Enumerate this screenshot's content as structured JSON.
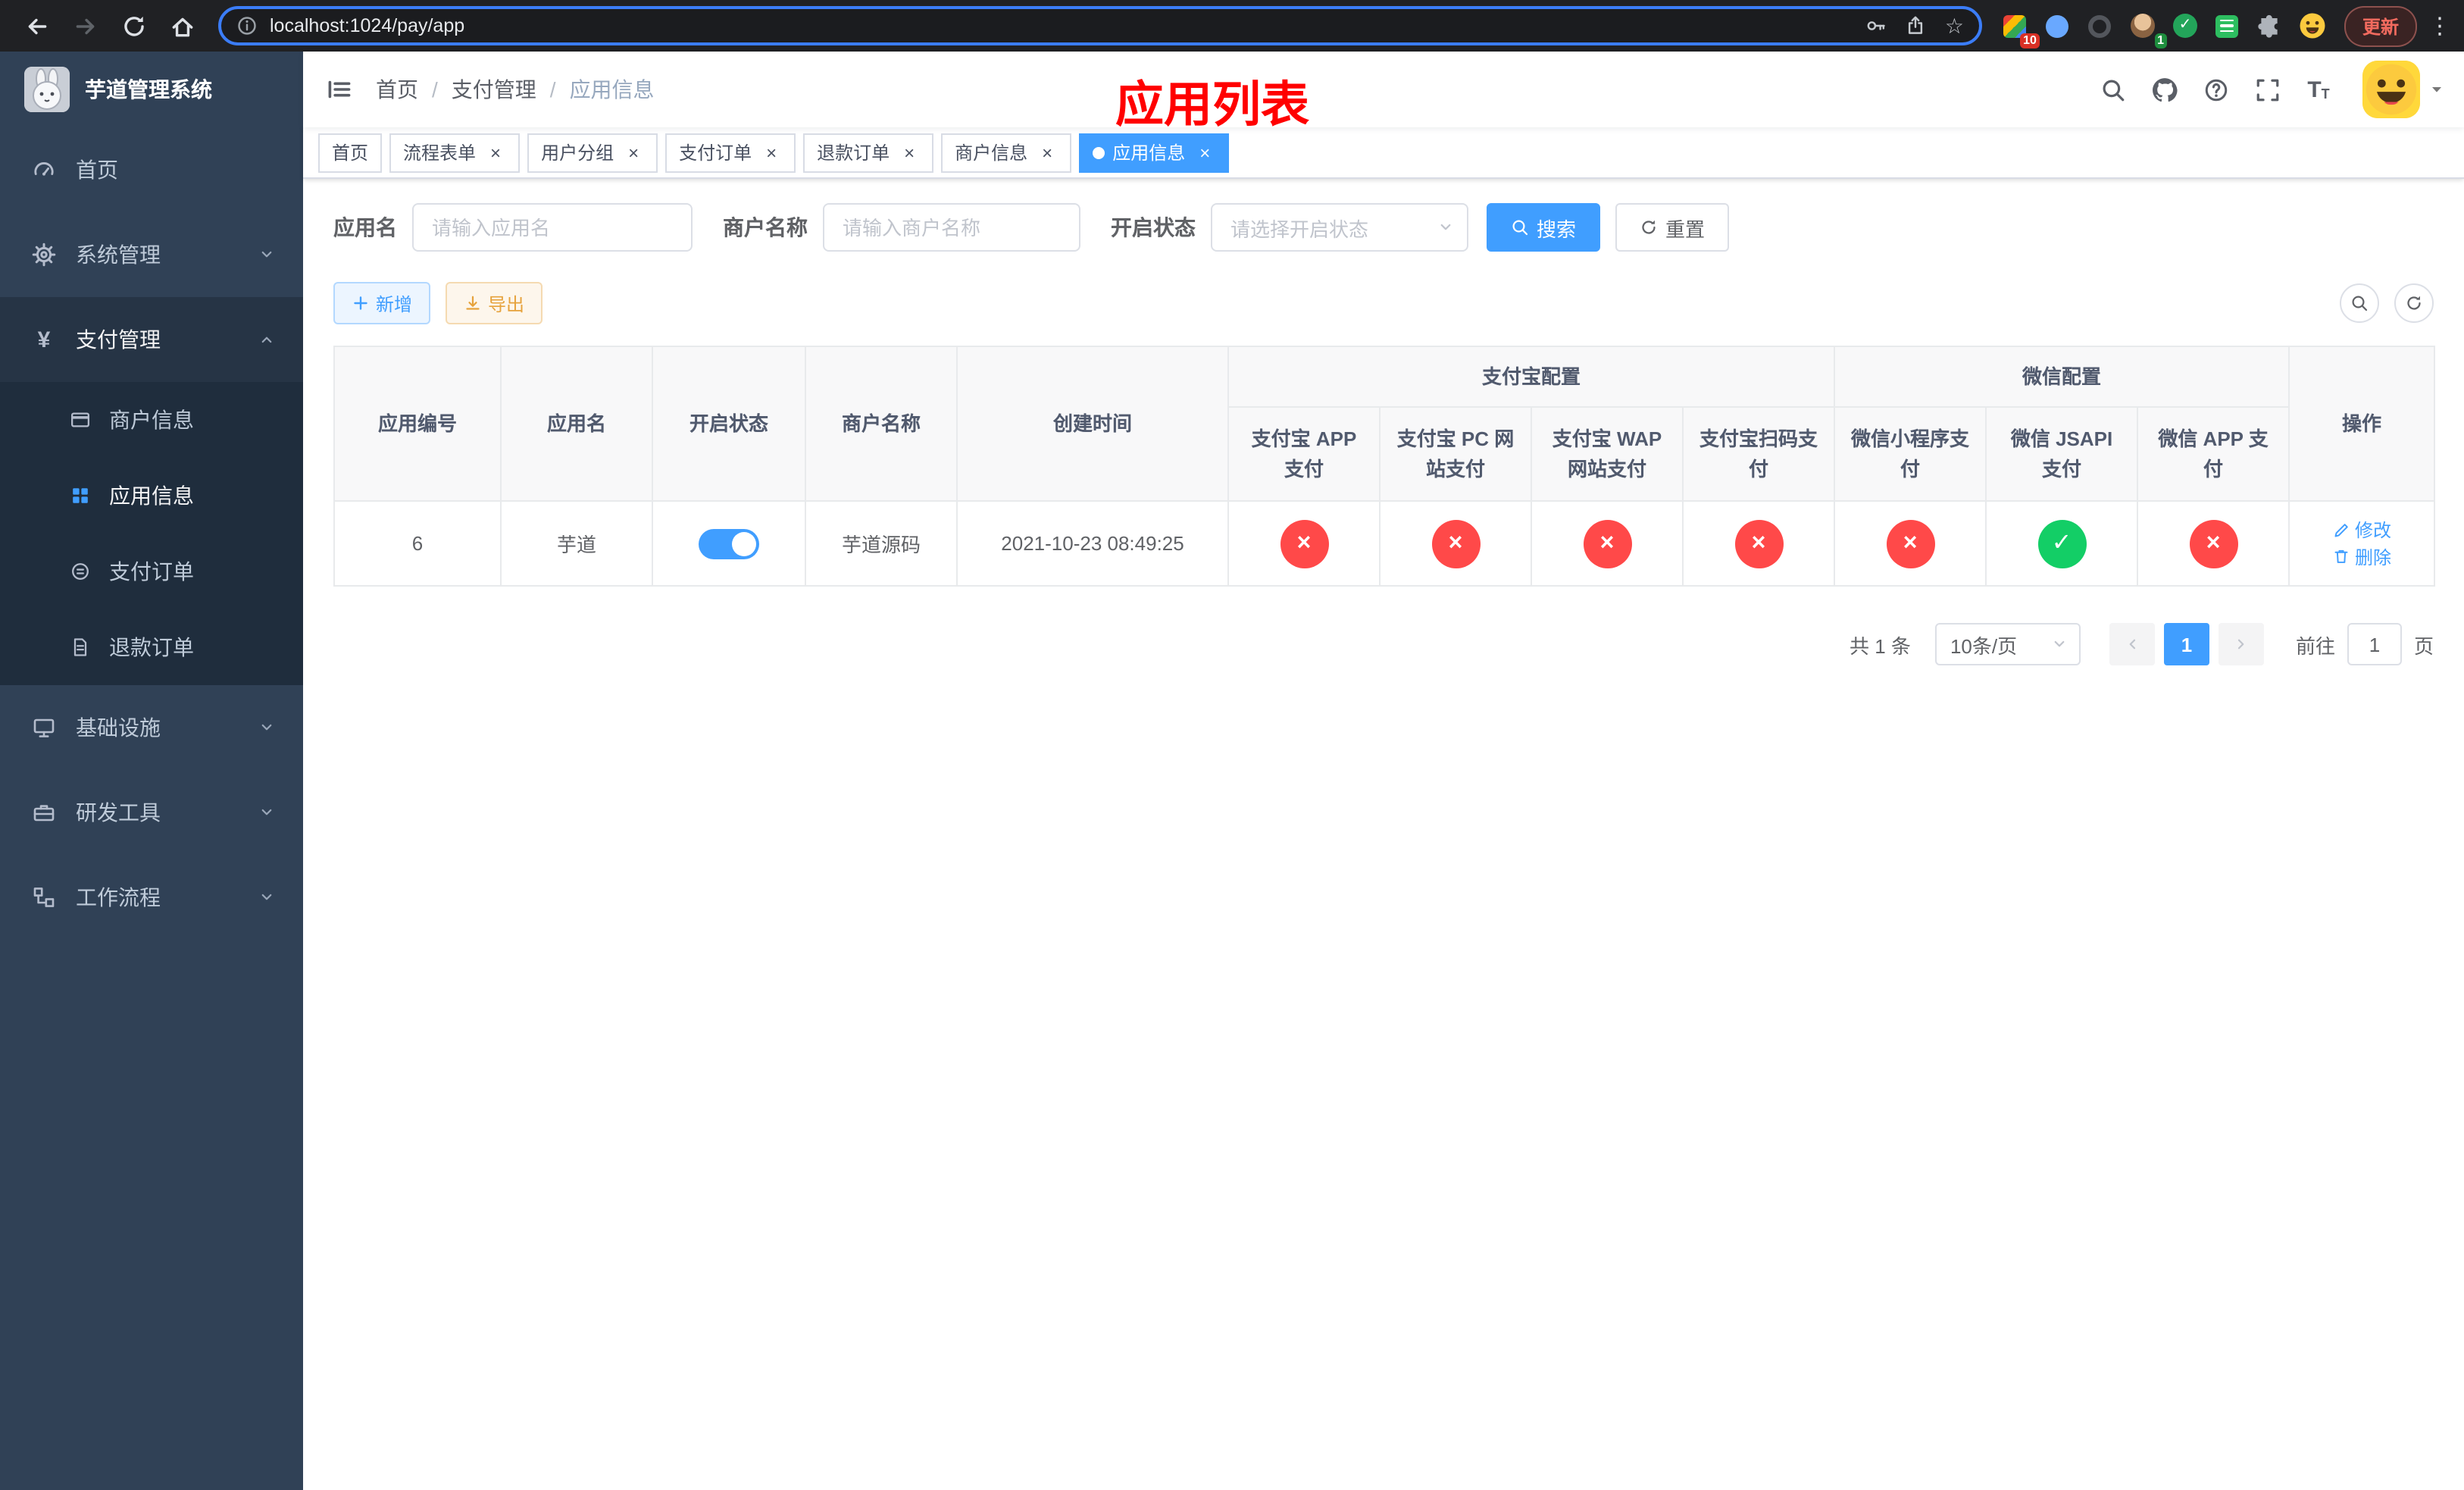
{
  "colors": {
    "accent": "#409eff",
    "success": "#13ce66",
    "danger": "#ff4949",
    "sidebar_bg": "#304156",
    "annotation": "#ff0000"
  },
  "browser": {
    "url": "localhost:1024/pay/app",
    "update_label": "更新",
    "extension_badge": "10",
    "avatar_badge": "1"
  },
  "sidebar": {
    "logo_title": "芋道管理系统",
    "items": [
      {
        "label": "首页"
      },
      {
        "label": "系统管理"
      },
      {
        "label": "支付管理",
        "children": [
          {
            "label": "商户信息"
          },
          {
            "label": "应用信息"
          },
          {
            "label": "支付订单"
          },
          {
            "label": "退款订单"
          }
        ]
      },
      {
        "label": "基础设施"
      },
      {
        "label": "研发工具"
      },
      {
        "label": "工作流程"
      }
    ]
  },
  "header": {
    "breadcrumb": [
      "首页",
      "支付管理",
      "应用信息"
    ],
    "separator": "/",
    "annotation": "应用列表"
  },
  "tabs": [
    {
      "label": "首页"
    },
    {
      "label": "流程表单"
    },
    {
      "label": "用户分组"
    },
    {
      "label": "支付订单"
    },
    {
      "label": "退款订单"
    },
    {
      "label": "商户信息"
    },
    {
      "label": "应用信息"
    }
  ],
  "filter": {
    "app_name_label": "应用名",
    "app_name_placeholder": "请输入应用名",
    "merchant_label": "商户名称",
    "merchant_placeholder": "请输入商户名称",
    "status_label": "开启状态",
    "status_placeholder": "请选择开启状态",
    "search": "搜索",
    "reset": "重置"
  },
  "toolbar": {
    "add": "新增",
    "export": "导出"
  },
  "table": {
    "columns": {
      "app_id": "应用编号",
      "app_name": "应用名",
      "status": "开启状态",
      "merchant": "商户名称",
      "created": "创建时间",
      "alipay_group": "支付宝配置",
      "alipay_app": "支付宝 APP 支付",
      "alipay_pc": "支付宝 PC 网站支付",
      "alipay_wap": "支付宝 WAP 网站支付",
      "alipay_qr": "支付宝扫码支付",
      "wechat_group": "微信配置",
      "wechat_mini": "微信小程序支付",
      "wechat_jsapi": "微信 JSAPI 支付",
      "wechat_app": "微信 APP 支付",
      "actions": "操作"
    },
    "row": {
      "app_id": "6",
      "app_name": "芋道",
      "enabled": true,
      "merchant": "芋道源码",
      "created": "2021-10-23 08:49:25",
      "configs": {
        "alipay_app": false,
        "alipay_pc": false,
        "alipay_wap": false,
        "alipay_qr": false,
        "wechat_mini": false,
        "wechat_jsapi": true,
        "wechat_app": false
      },
      "edit": "修改",
      "delete": "删除"
    }
  },
  "pagination": {
    "total": "共 1 条",
    "page_size": "10条/页",
    "page": "1",
    "goto_label": "前往",
    "goto_value": "1",
    "page_unit": "页"
  }
}
